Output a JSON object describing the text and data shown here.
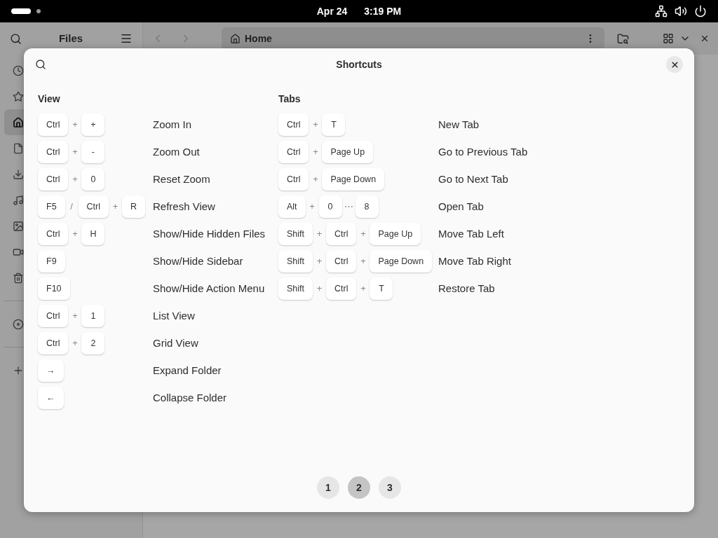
{
  "top_bar": {
    "date": "Apr 24",
    "time": "3:19 PM"
  },
  "files_window": {
    "title": "Files",
    "back_disabled": true,
    "forward_disabled": true,
    "path": "Home",
    "sidebar": {
      "groups": [
        {
          "items": [
            {
              "kind": "recent",
              "selected": false
            },
            {
              "kind": "starred",
              "selected": false
            },
            {
              "kind": "home",
              "selected": true
            },
            {
              "kind": "documents",
              "selected": false
            },
            {
              "kind": "downloads",
              "selected": false
            },
            {
              "kind": "music",
              "selected": false
            },
            {
              "kind": "pictures",
              "selected": false
            },
            {
              "kind": "videos",
              "selected": false
            },
            {
              "kind": "trash",
              "selected": false
            }
          ]
        },
        {
          "items": [
            {
              "kind": "disc",
              "selected": false
            }
          ]
        },
        {
          "items": [
            {
              "kind": "add",
              "selected": false
            }
          ]
        }
      ]
    }
  },
  "dialog": {
    "title": "Shortcuts",
    "sections": [
      {
        "title": "View",
        "shortcuts": [
          {
            "keys": [
              {
                "kind": "key",
                "text": "Ctrl"
              },
              {
                "kind": "sep",
                "text": "+"
              },
              {
                "kind": "key",
                "text": "+"
              }
            ],
            "action": "Zoom In"
          },
          {
            "keys": [
              {
                "kind": "key",
                "text": "Ctrl"
              },
              {
                "kind": "sep",
                "text": "+"
              },
              {
                "kind": "key",
                "text": "-"
              }
            ],
            "action": "Zoom Out"
          },
          {
            "keys": [
              {
                "kind": "key",
                "text": "Ctrl"
              },
              {
                "kind": "sep",
                "text": "+"
              },
              {
                "kind": "key",
                "text": "0"
              }
            ],
            "action": "Reset Zoom"
          },
          {
            "keys": [
              {
                "kind": "key",
                "text": "F5"
              },
              {
                "kind": "sep",
                "text": "/"
              },
              {
                "kind": "key",
                "text": "Ctrl"
              },
              {
                "kind": "sep",
                "text": "+"
              },
              {
                "kind": "key",
                "text": "R"
              }
            ],
            "action": "Refresh View"
          },
          {
            "keys": [
              {
                "kind": "key",
                "text": "Ctrl"
              },
              {
                "kind": "sep",
                "text": "+"
              },
              {
                "kind": "key",
                "text": "H"
              }
            ],
            "action": "Show/Hide Hidden Files"
          },
          {
            "keys": [
              {
                "kind": "key",
                "text": "F9"
              }
            ],
            "action": "Show/Hide Sidebar"
          },
          {
            "keys": [
              {
                "kind": "key",
                "text": "F10"
              }
            ],
            "action": "Show/Hide Action Menu"
          },
          {
            "keys": [
              {
                "kind": "key",
                "text": "Ctrl"
              },
              {
                "kind": "sep",
                "text": "+"
              },
              {
                "kind": "key",
                "text": "1"
              }
            ],
            "action": "List View"
          },
          {
            "keys": [
              {
                "kind": "key",
                "text": "Ctrl"
              },
              {
                "kind": "sep",
                "text": "+"
              },
              {
                "kind": "key",
                "text": "2"
              }
            ],
            "action": "Grid View"
          },
          {
            "keys": [
              {
                "kind": "key",
                "text": "→"
              }
            ],
            "action": "Expand Folder"
          },
          {
            "keys": [
              {
                "kind": "key",
                "text": "←"
              }
            ],
            "action": "Collapse Folder"
          }
        ]
      },
      {
        "title": "Tabs",
        "shortcuts": [
          {
            "keys": [
              {
                "kind": "key",
                "text": "Ctrl"
              },
              {
                "kind": "sep",
                "text": "+"
              },
              {
                "kind": "key",
                "text": "T"
              }
            ],
            "action": "New Tab"
          },
          {
            "keys": [
              {
                "kind": "key",
                "text": "Ctrl"
              },
              {
                "kind": "sep",
                "text": "+"
              },
              {
                "kind": "key",
                "text": "Page Up"
              }
            ],
            "action": "Go to Previous Tab"
          },
          {
            "keys": [
              {
                "kind": "key",
                "text": "Ctrl"
              },
              {
                "kind": "sep",
                "text": "+"
              },
              {
                "kind": "key",
                "text": "Page Down"
              }
            ],
            "action": "Go to Next Tab"
          },
          {
            "keys": [
              {
                "kind": "key",
                "text": "Alt"
              },
              {
                "kind": "sep",
                "text": "+"
              },
              {
                "kind": "key",
                "text": "0"
              },
              {
                "kind": "sep",
                "text": "⋯"
              },
              {
                "kind": "key",
                "text": "8"
              }
            ],
            "action": "Open Tab"
          },
          {
            "keys": [
              {
                "kind": "key",
                "text": "Shift"
              },
              {
                "kind": "sep",
                "text": "+"
              },
              {
                "kind": "key",
                "text": "Ctrl"
              },
              {
                "kind": "sep",
                "text": "+"
              },
              {
                "kind": "key",
                "text": "Page Up"
              }
            ],
            "action": "Move Tab Left"
          },
          {
            "keys": [
              {
                "kind": "key",
                "text": "Shift"
              },
              {
                "kind": "sep",
                "text": "+"
              },
              {
                "kind": "key",
                "text": "Ctrl"
              },
              {
                "kind": "sep",
                "text": "+"
              },
              {
                "kind": "key",
                "text": "Page Down"
              }
            ],
            "action": "Move Tab Right"
          },
          {
            "keys": [
              {
                "kind": "key",
                "text": "Shift"
              },
              {
                "kind": "sep",
                "text": "+"
              },
              {
                "kind": "key",
                "text": "Ctrl"
              },
              {
                "kind": "sep",
                "text": "+"
              },
              {
                "kind": "key",
                "text": "T"
              }
            ],
            "action": "Restore Tab"
          }
        ]
      }
    ],
    "pages": [
      {
        "label": "1",
        "selected": false
      },
      {
        "label": "2",
        "selected": true
      },
      {
        "label": "3",
        "selected": false
      }
    ]
  }
}
